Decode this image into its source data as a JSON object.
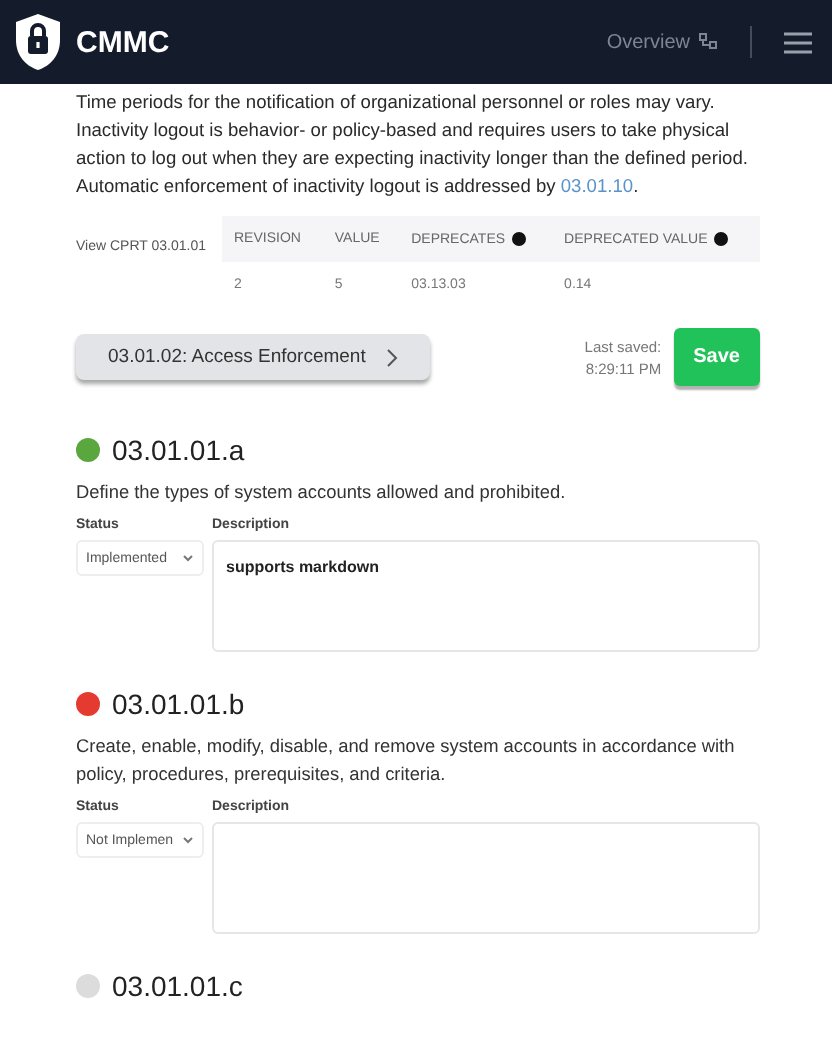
{
  "header": {
    "brand": "CMMC",
    "nav_link": "Overview"
  },
  "intro": {
    "text": "Time periods for the notification of organizational personnel or roles may vary. Inactivity logout is behavior- or policy-based and requires users to take physical action to log out when they are expecting inactivity longer than the defined period. Automatic enforcement of inactivity logout is addressed by",
    "link": "03.01.10",
    "after": "."
  },
  "cprt": {
    "link": "View CPRT 03.01.01",
    "columns": [
      {
        "label": "REVISION",
        "info": false
      },
      {
        "label": "VALUE",
        "info": false
      },
      {
        "label": "DEPRECATES",
        "info": true
      },
      {
        "label": "DEPRECATED VALUE",
        "info": true
      }
    ],
    "row": [
      "2",
      "5",
      "03.13.03",
      "0.14"
    ]
  },
  "next_button": "03.01.02: Access Enforcement",
  "last_saved": {
    "label": "Last saved:",
    "time": "8:29:11 PM"
  },
  "save_button": "Save",
  "requirements": [
    {
      "id": "03.01.01.a",
      "color": "#5aa63f",
      "text": "Define the types of system accounts allowed and prohibited.",
      "fields": {
        "status_label": "Status",
        "status": "Implemented",
        "description_label": "Description",
        "description": "supports markdown"
      }
    },
    {
      "id": "03.01.01.b",
      "color": "#e53a2f",
      "text": "Create, enable, modify, disable, and remove system accounts in accordance with policy, procedures, prerequisites, and criteria.",
      "fields": {
        "status_label": "Status",
        "status": "Not Implemen",
        "description_label": "Description"
      }
    },
    {
      "id": "03.01.01.c",
      "color": "#dcdcdc"
    }
  ]
}
